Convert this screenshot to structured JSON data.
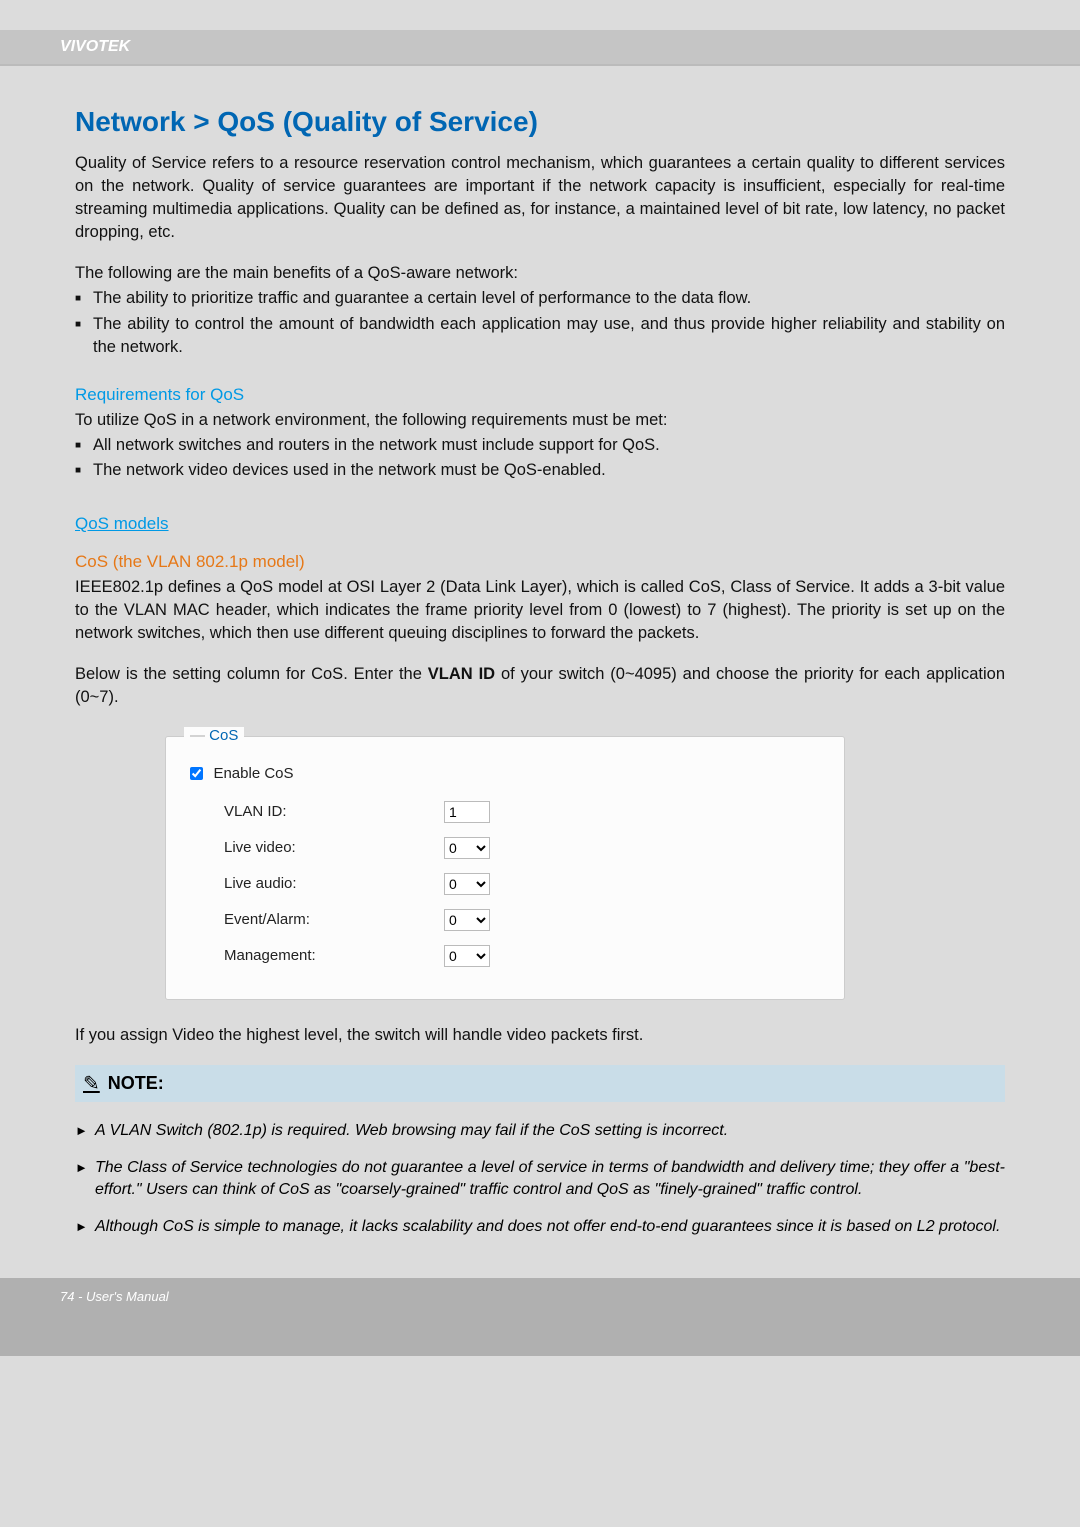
{
  "header": {
    "brand": "VIVOTEK"
  },
  "title": "Network > QoS (Quality of Service)",
  "intro1": "Quality of Service refers to a resource reservation control mechanism, which guarantees a certain quality to different services on the network. Quality of service guarantees are important if the network capacity is insufficient, especially for real-time streaming multimedia applications. Quality can be defined as, for instance, a maintained level of bit rate, low latency, no packet dropping, etc.",
  "intro2": "The following are the main benefits of a QoS-aware network:",
  "benefits": [
    "The ability to prioritize traffic and guarantee a certain level of performance to the data flow.",
    "The ability to control the amount of bandwidth each application may use, and thus provide higher reliability and stability on the network."
  ],
  "req_heading": "Requirements for QoS",
  "req_intro": "To utilize QoS in a network environment, the following requirements must be met:",
  "req_items": [
    "All network switches and routers in the network must include support for QoS.",
    "The network video devices used in the network must be QoS-enabled."
  ],
  "models_heading": "QoS models",
  "cos_heading": "CoS (the VLAN 802.1p model)",
  "cos_para": "IEEE802.1p defines a QoS model at OSI Layer 2 (Data Link Layer), which is called CoS, Class of Service. It adds a 3-bit value to the VLAN MAC header, which indicates the frame priority level from 0 (lowest) to 7 (highest). The priority is set up on the network switches, which then use different queuing disciplines to forward the packets.",
  "cos_below_a": "Below is the setting column for CoS. Enter the ",
  "cos_below_b": "VLAN ID",
  "cos_below_c": " of your switch (0~4095) and choose the priority for each application (0~7).",
  "panel": {
    "legend": "CoS",
    "enable_label": "Enable CoS",
    "enable_checked": true,
    "rows": {
      "vlan": {
        "label": "VLAN ID:",
        "value": "1"
      },
      "live_video": {
        "label": "Live video:",
        "value": "0"
      },
      "live_audio": {
        "label": "Live audio:",
        "value": "0"
      },
      "event": {
        "label": "Event/Alarm:",
        "value": "0"
      },
      "mgmt": {
        "label": "Management:",
        "value": "0"
      }
    }
  },
  "after_panel": "If you assign Video the highest level, the switch will handle video packets first.",
  "note_label": "NOTE:",
  "notes": [
    "A VLAN Switch (802.1p) is required. Web browsing may fail if the CoS setting is incorrect.",
    "The Class of Service technologies do not guarantee a level of service in terms of bandwidth and delivery time; they offer a \"best-effort.\" Users can think of CoS as \"coarsely-grained\" traffic control and QoS as \"finely-grained\" traffic control.",
    "Although CoS is simple to manage, it lacks scalability and does not offer end-to-end guarantees since it is based on L2 protocol."
  ],
  "footer": "74 - User's Manual"
}
